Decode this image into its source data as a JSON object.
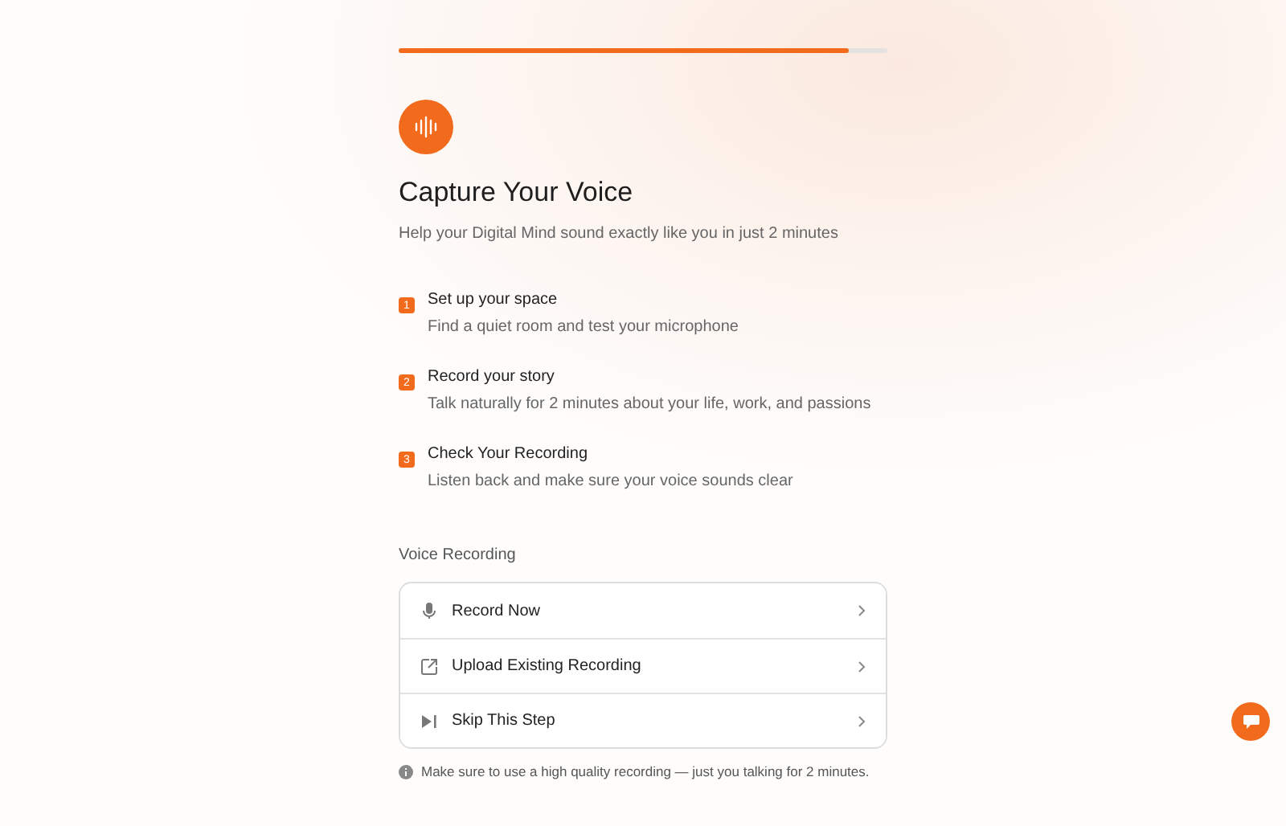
{
  "progress": {
    "level": 0.92
  },
  "header": {
    "title": "Capture Your Voice",
    "subtitle": "Help your Digital Mind sound exactly like you in just 2 minutes"
  },
  "steps": [
    {
      "number": "1",
      "title": "Set up your space",
      "description": "Find a quiet room and test your microphone"
    },
    {
      "number": "2",
      "title": "Record your story",
      "description": "Talk naturally for 2 minutes about your life, work, and passions"
    },
    {
      "number": "3",
      "title": "Check Your Recording",
      "description": "Listen back and make sure your voice sounds clear"
    }
  ],
  "options_section": {
    "label": "Voice Recording",
    "options": [
      {
        "kind": "record",
        "label": "Record Now"
      },
      {
        "kind": "upload",
        "label": "Upload Existing Recording"
      },
      {
        "kind": "skip",
        "label": "Skip This Step"
      }
    ]
  },
  "note": "Make sure to use a high quality recording — just you talking for 2 minutes."
}
